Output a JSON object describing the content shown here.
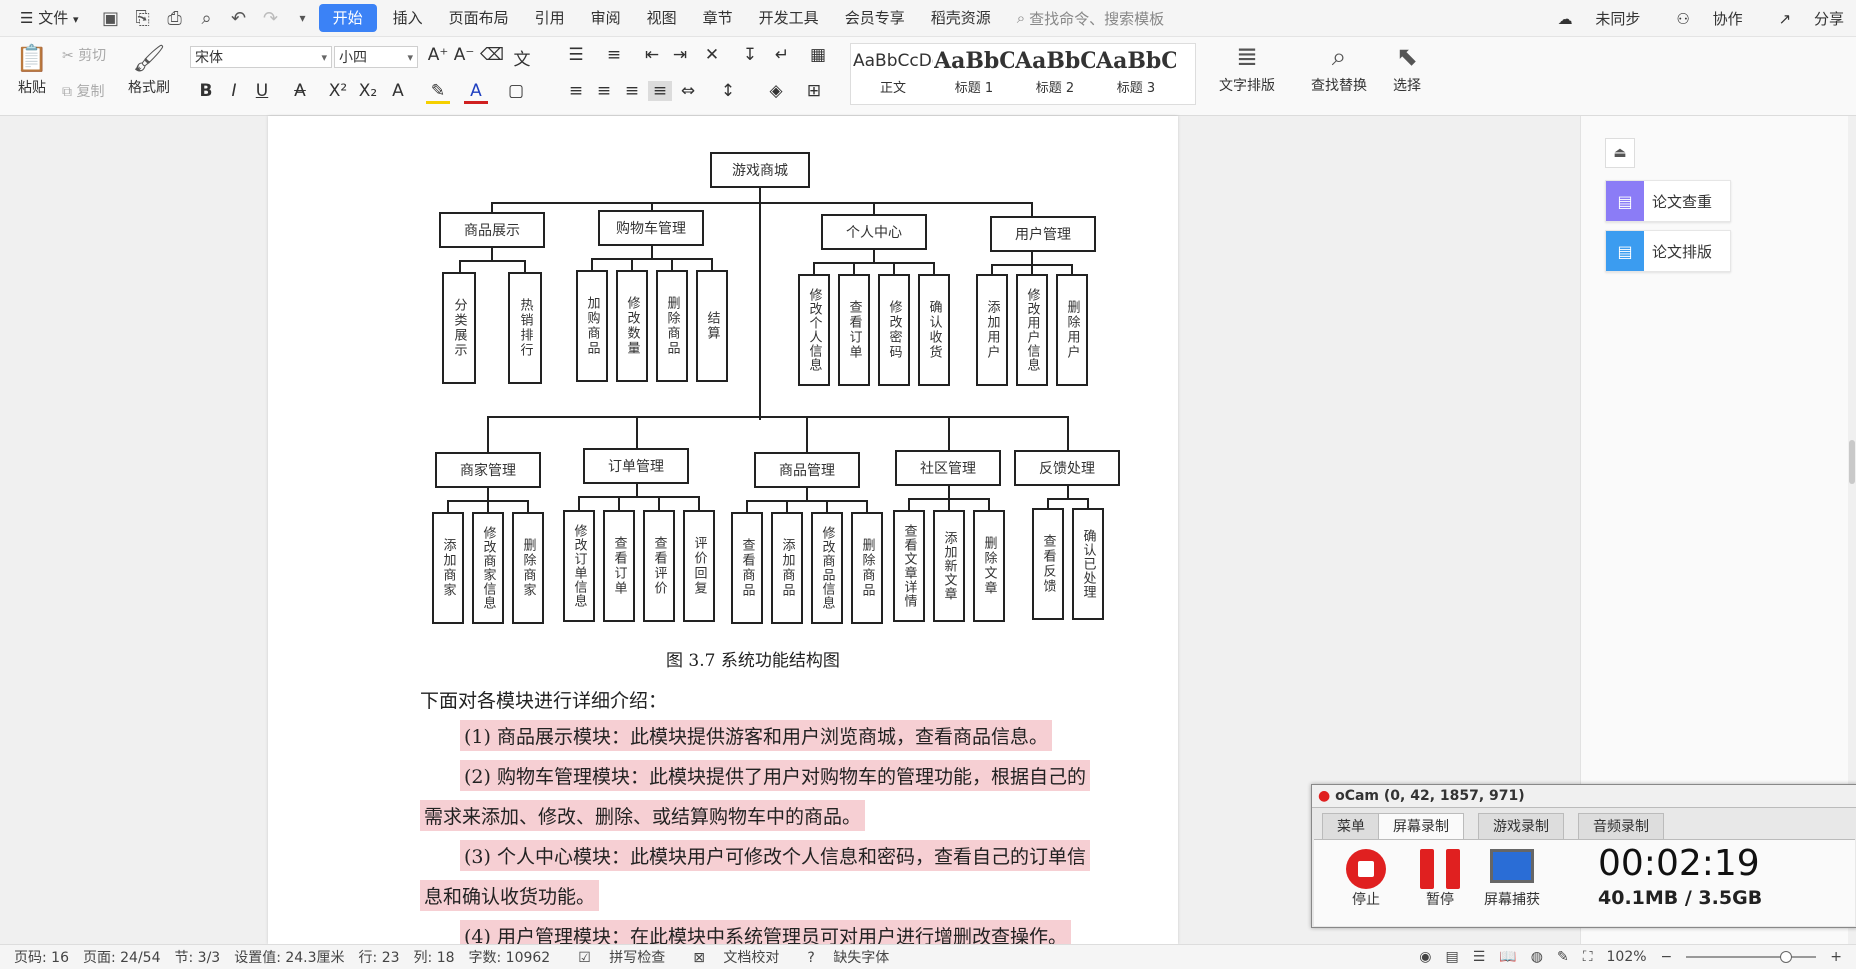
{
  "menubar": {
    "file": "文件",
    "tabs": [
      "开始",
      "插入",
      "页面布局",
      "引用",
      "审阅",
      "视图",
      "章节",
      "开发工具",
      "会员专享",
      "稻壳资源"
    ],
    "search_placeholder": "查找命令、搜索模板",
    "right": [
      "未同步",
      "协作",
      "分享"
    ]
  },
  "ribbon": {
    "paste": "粘贴",
    "cut": "剪切",
    "copy": "复制",
    "format_painter": "格式刷",
    "font_name": "宋体",
    "font_size": "小四",
    "styles": [
      {
        "preview": "AaBbCcDd",
        "label": "正文"
      },
      {
        "preview": "AaBbC",
        "label": "标题 1"
      },
      {
        "preview": "AaBbC",
        "label": "标题 2"
      },
      {
        "preview": "AaBbC",
        "label": "标题 3"
      }
    ],
    "text_layout": "文字排版",
    "find_replace": "查找替换",
    "select": "选择"
  },
  "diagram": {
    "root": "游戏商城",
    "top_groups": [
      {
        "name": "商品展示",
        "children": [
          "分类展示",
          "热销排行"
        ]
      },
      {
        "name": "购物车管理",
        "children": [
          "加购商品",
          "修改数量",
          "删除商品",
          "结算"
        ]
      },
      {
        "name": "个人中心",
        "children": [
          "修改个人信息",
          "查看订单",
          "修改密码",
          "确认收货"
        ]
      },
      {
        "name": "用户管理",
        "children": [
          "添加用户",
          "修改用户信息",
          "删除用户"
        ]
      }
    ],
    "bottom_groups": [
      {
        "name": "商家管理",
        "children": [
          "添加商家",
          "修改商家信息",
          "删除商家"
        ]
      },
      {
        "name": "订单管理",
        "children": [
          "修改订单信息",
          "查看订单",
          "查看评价",
          "评价回复"
        ]
      },
      {
        "name": "商品管理",
        "children": [
          "查看商品",
          "添加商品",
          "修改商品信息",
          "删除商品"
        ]
      },
      {
        "name": "社区管理",
        "children": [
          "查看文章详情",
          "添加新文章",
          "删除文章"
        ]
      },
      {
        "name": "反馈处理",
        "children": [
          "查看反馈",
          "确认已处理"
        ]
      }
    ],
    "caption": "图 3.7  系统功能结构图"
  },
  "body": {
    "intro": "下面对各模块进行详细介绍：",
    "p1": "(1) 商品展示模块：此模块提供游客和用户浏览商城，查看商品信息。",
    "p2a": "(2) 购物车管理模块：此模块提供了用户对购物车的管理功能，根据自己的",
    "p2b": "需求来添加、修改、删除、或结算购物车中的商品。",
    "p3a": "(3) 个人中心模块：此模块用户可修改个人信息和密码，查看自己的订单信",
    "p3b": "息和确认收货功能。",
    "p4a": "(4) 用户管理模块：在此模块中系统管理员可对用户进行增删改查操作。"
  },
  "panel": {
    "check": "论文查重",
    "layout": "论文排版"
  },
  "status": {
    "page_num": "页码: 16",
    "pages": "页面: 24/54",
    "section": "节: 3/3",
    "setting": "设置值: 24.3厘米",
    "row": "行: 23",
    "col": "列: 18",
    "words": "字数: 10962",
    "spell": "拼写检查",
    "proof": "文档校对",
    "missing_font": "缺失字体",
    "zoom": "102%"
  },
  "ocam": {
    "title": "oCam (0, 42, 1857, 971)",
    "tabs": [
      "菜单",
      "屏幕录制",
      "游戏录制",
      "音频录制"
    ],
    "stop": "停止",
    "pause": "暂停",
    "capture": "屏幕捕获",
    "time": "00:02:19",
    "size": "40.1MB / 3.5GB"
  },
  "colors": {
    "accent": "#3b82f6",
    "highlight": "#f6cfd3",
    "rec_red": "#e02020"
  }
}
